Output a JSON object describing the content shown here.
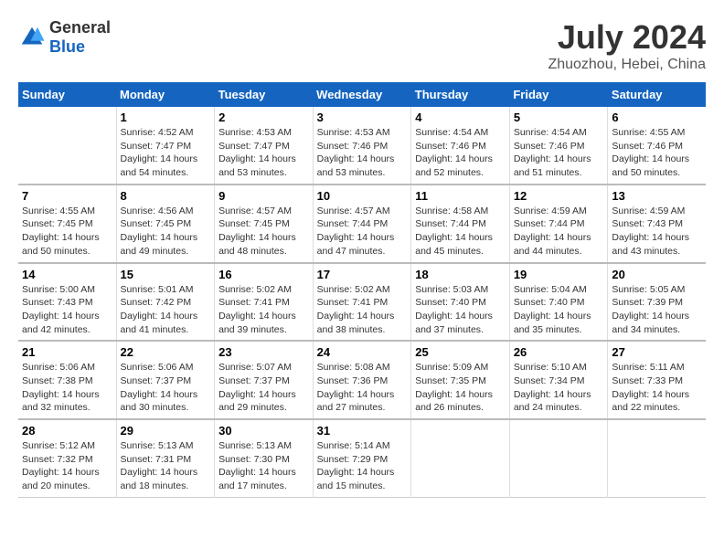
{
  "logo": {
    "general": "General",
    "blue": "Blue"
  },
  "title": "July 2024",
  "subtitle": "Zhuozhou, Hebei, China",
  "days_of_week": [
    "Sunday",
    "Monday",
    "Tuesday",
    "Wednesday",
    "Thursday",
    "Friday",
    "Saturday"
  ],
  "weeks": [
    [
      {
        "day": "",
        "info": ""
      },
      {
        "day": "1",
        "info": "Sunrise: 4:52 AM\nSunset: 7:47 PM\nDaylight: 14 hours\nand 54 minutes."
      },
      {
        "day": "2",
        "info": "Sunrise: 4:53 AM\nSunset: 7:47 PM\nDaylight: 14 hours\nand 53 minutes."
      },
      {
        "day": "3",
        "info": "Sunrise: 4:53 AM\nSunset: 7:46 PM\nDaylight: 14 hours\nand 53 minutes."
      },
      {
        "day": "4",
        "info": "Sunrise: 4:54 AM\nSunset: 7:46 PM\nDaylight: 14 hours\nand 52 minutes."
      },
      {
        "day": "5",
        "info": "Sunrise: 4:54 AM\nSunset: 7:46 PM\nDaylight: 14 hours\nand 51 minutes."
      },
      {
        "day": "6",
        "info": "Sunrise: 4:55 AM\nSunset: 7:46 PM\nDaylight: 14 hours\nand 50 minutes."
      }
    ],
    [
      {
        "day": "7",
        "info": "Sunrise: 4:55 AM\nSunset: 7:45 PM\nDaylight: 14 hours\nand 50 minutes."
      },
      {
        "day": "8",
        "info": "Sunrise: 4:56 AM\nSunset: 7:45 PM\nDaylight: 14 hours\nand 49 minutes."
      },
      {
        "day": "9",
        "info": "Sunrise: 4:57 AM\nSunset: 7:45 PM\nDaylight: 14 hours\nand 48 minutes."
      },
      {
        "day": "10",
        "info": "Sunrise: 4:57 AM\nSunset: 7:44 PM\nDaylight: 14 hours\nand 47 minutes."
      },
      {
        "day": "11",
        "info": "Sunrise: 4:58 AM\nSunset: 7:44 PM\nDaylight: 14 hours\nand 45 minutes."
      },
      {
        "day": "12",
        "info": "Sunrise: 4:59 AM\nSunset: 7:44 PM\nDaylight: 14 hours\nand 44 minutes."
      },
      {
        "day": "13",
        "info": "Sunrise: 4:59 AM\nSunset: 7:43 PM\nDaylight: 14 hours\nand 43 minutes."
      }
    ],
    [
      {
        "day": "14",
        "info": "Sunrise: 5:00 AM\nSunset: 7:43 PM\nDaylight: 14 hours\nand 42 minutes."
      },
      {
        "day": "15",
        "info": "Sunrise: 5:01 AM\nSunset: 7:42 PM\nDaylight: 14 hours\nand 41 minutes."
      },
      {
        "day": "16",
        "info": "Sunrise: 5:02 AM\nSunset: 7:41 PM\nDaylight: 14 hours\nand 39 minutes."
      },
      {
        "day": "17",
        "info": "Sunrise: 5:02 AM\nSunset: 7:41 PM\nDaylight: 14 hours\nand 38 minutes."
      },
      {
        "day": "18",
        "info": "Sunrise: 5:03 AM\nSunset: 7:40 PM\nDaylight: 14 hours\nand 37 minutes."
      },
      {
        "day": "19",
        "info": "Sunrise: 5:04 AM\nSunset: 7:40 PM\nDaylight: 14 hours\nand 35 minutes."
      },
      {
        "day": "20",
        "info": "Sunrise: 5:05 AM\nSunset: 7:39 PM\nDaylight: 14 hours\nand 34 minutes."
      }
    ],
    [
      {
        "day": "21",
        "info": "Sunrise: 5:06 AM\nSunset: 7:38 PM\nDaylight: 14 hours\nand 32 minutes."
      },
      {
        "day": "22",
        "info": "Sunrise: 5:06 AM\nSunset: 7:37 PM\nDaylight: 14 hours\nand 30 minutes."
      },
      {
        "day": "23",
        "info": "Sunrise: 5:07 AM\nSunset: 7:37 PM\nDaylight: 14 hours\nand 29 minutes."
      },
      {
        "day": "24",
        "info": "Sunrise: 5:08 AM\nSunset: 7:36 PM\nDaylight: 14 hours\nand 27 minutes."
      },
      {
        "day": "25",
        "info": "Sunrise: 5:09 AM\nSunset: 7:35 PM\nDaylight: 14 hours\nand 26 minutes."
      },
      {
        "day": "26",
        "info": "Sunrise: 5:10 AM\nSunset: 7:34 PM\nDaylight: 14 hours\nand 24 minutes."
      },
      {
        "day": "27",
        "info": "Sunrise: 5:11 AM\nSunset: 7:33 PM\nDaylight: 14 hours\nand 22 minutes."
      }
    ],
    [
      {
        "day": "28",
        "info": "Sunrise: 5:12 AM\nSunset: 7:32 PM\nDaylight: 14 hours\nand 20 minutes."
      },
      {
        "day": "29",
        "info": "Sunrise: 5:13 AM\nSunset: 7:31 PM\nDaylight: 14 hours\nand 18 minutes."
      },
      {
        "day": "30",
        "info": "Sunrise: 5:13 AM\nSunset: 7:30 PM\nDaylight: 14 hours\nand 17 minutes."
      },
      {
        "day": "31",
        "info": "Sunrise: 5:14 AM\nSunset: 7:29 PM\nDaylight: 14 hours\nand 15 minutes."
      },
      {
        "day": "",
        "info": ""
      },
      {
        "day": "",
        "info": ""
      },
      {
        "day": "",
        "info": ""
      }
    ]
  ]
}
